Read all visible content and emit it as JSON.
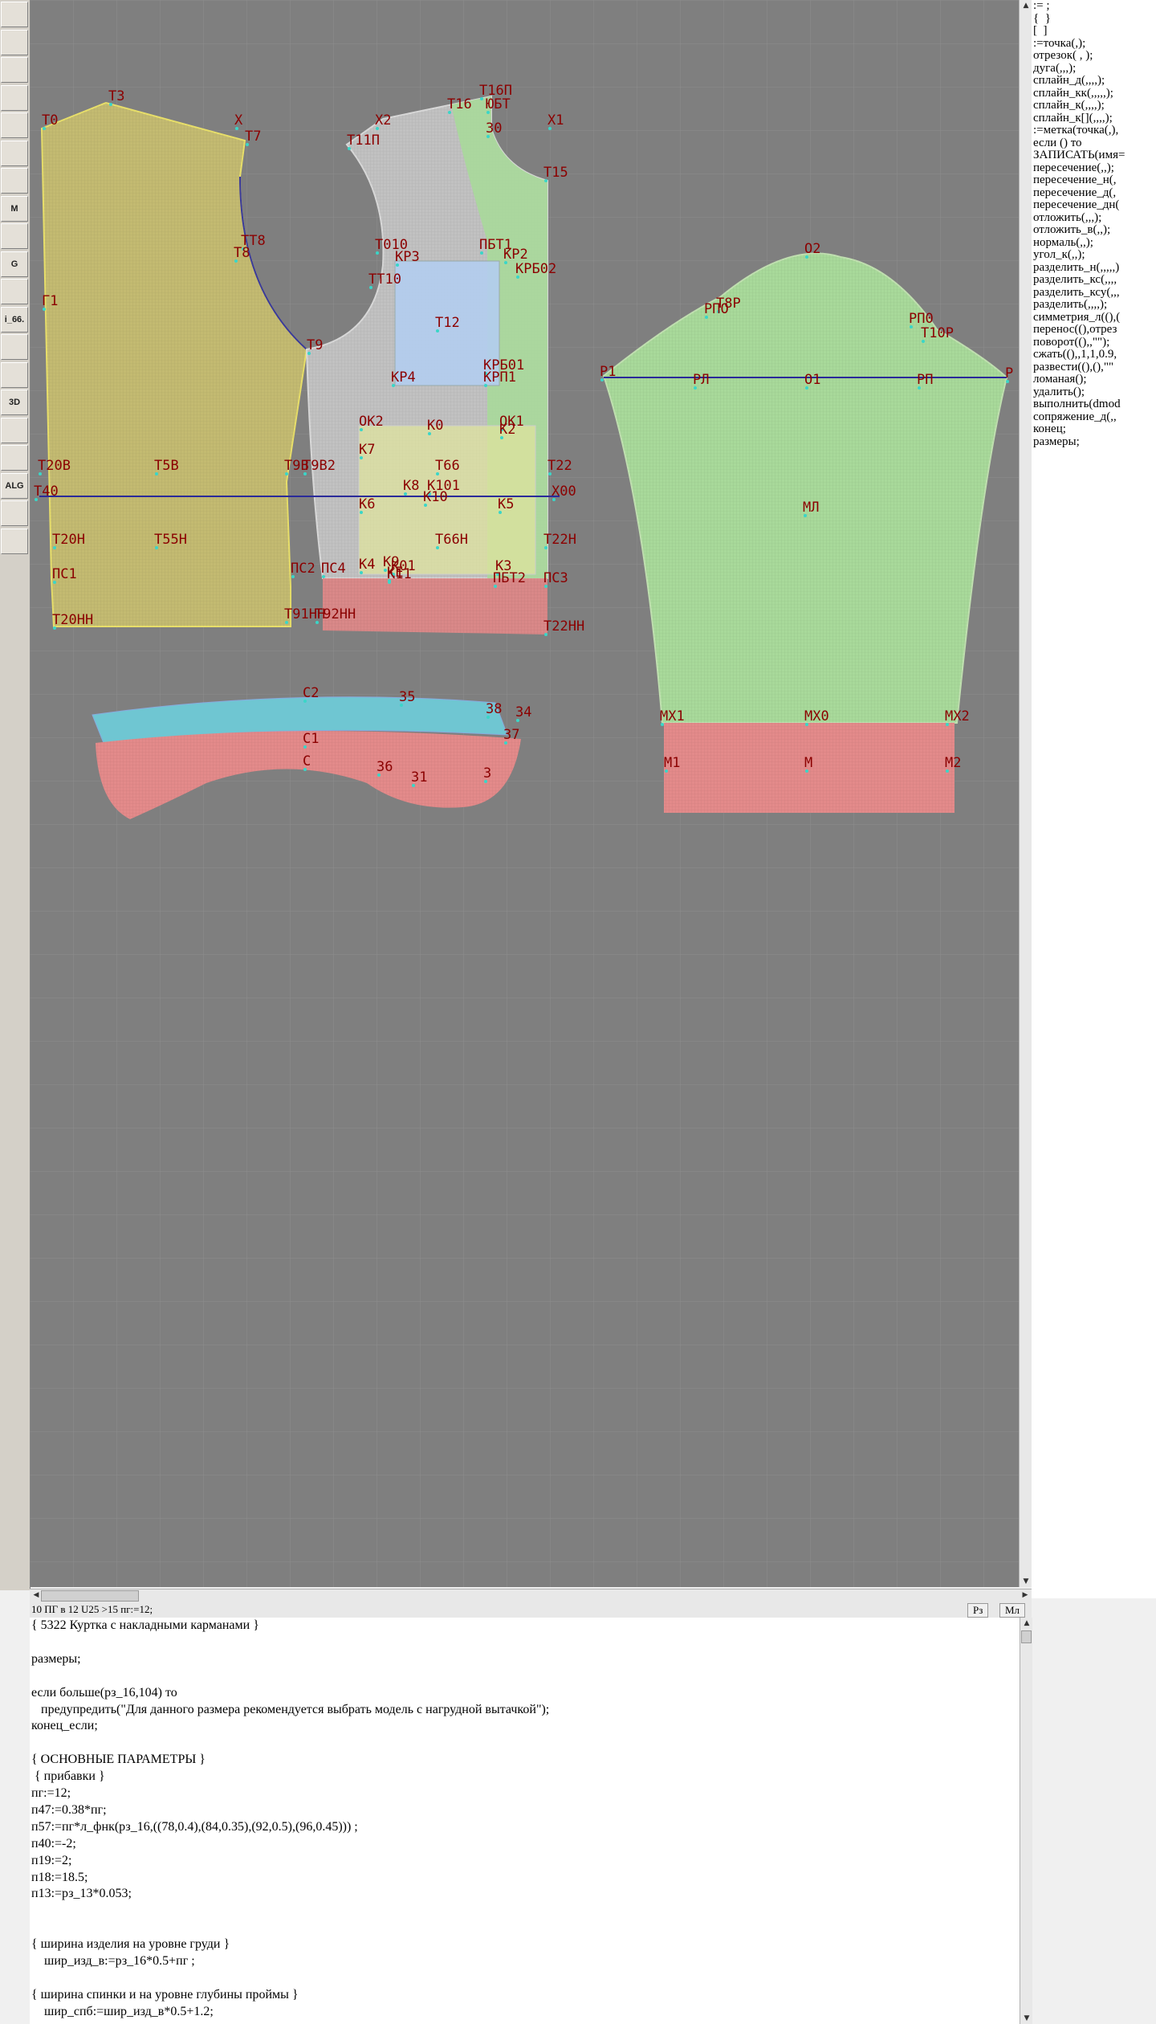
{
  "toolbar": {
    "buttons": [
      {
        "icon": "zoom-in-icon",
        "text": ""
      },
      {
        "icon": "zoom-out-icon",
        "text": ""
      },
      {
        "icon": "pattern-icon",
        "text": ""
      },
      {
        "icon": "grid-icon",
        "text": ""
      },
      {
        "icon": "line-icon",
        "text": ""
      },
      {
        "icon": "book-icon",
        "text": ""
      },
      {
        "icon": "ruler-icon",
        "text": ""
      },
      {
        "icon": "model-icon",
        "text": "M"
      },
      {
        "icon": "compass-icon",
        "text": ""
      },
      {
        "icon": "g-tool-icon",
        "text": "G"
      },
      {
        "icon": "measure-icon",
        "text": ""
      },
      {
        "icon": "file-label-icon",
        "text": "i_66."
      },
      {
        "icon": "spreadsheet-icon",
        "text": ""
      },
      {
        "icon": "figure-icon",
        "text": ""
      },
      {
        "icon": "3d-icon",
        "text": "3D"
      },
      {
        "icon": "layers-icon",
        "text": ""
      },
      {
        "icon": "stack-icon",
        "text": ""
      },
      {
        "icon": "algorithm-icon",
        "text": "ALG"
      },
      {
        "icon": "cut-icon",
        "text": ""
      },
      {
        "icon": "move-icon",
        "text": ""
      }
    ]
  },
  "canvas": {
    "colors": {
      "background": "#7f7f7f",
      "grid": "#8e8e8e",
      "back_fill": "#cfc46e",
      "front_fill": "#c9c9c9",
      "facing_fill": "#a8d99a",
      "pocket_fill": "#b3cdf0",
      "yoke_fill": "#dfe39d",
      "hem_fill": "#e38a8a",
      "collar_fill": "#6fc6d2",
      "sleeve_fill": "#a8d99a",
      "label": "#8b0000",
      "ref_line": "#2a2a9a"
    },
    "labels": {
      "back": [
        "Т0",
        "Т3",
        "Х",
        "Т7",
        "ТТ8",
        "Т8",
        "Г1",
        "Т9",
        "Т20В",
        "Т5В",
        "Т9В",
        "Т9В2",
        "Т40",
        "Т20Н",
        "Т55Н",
        "ПС1",
        "ПС2",
        "Т20НН",
        "Т91НН"
      ],
      "front": [
        "Х2",
        "Т16",
        "Т16П",
        "ЮБТ",
        "Т11П",
        "30",
        "Х1",
        "Т15",
        "Т010",
        "КР3",
        "ПБТ1",
        "КР2",
        "КРБ02",
        "ТТ10",
        "Т12",
        "КРБ01",
        "КР4",
        "КРП1",
        "ОК2",
        "К0",
        "ОК1",
        "К2",
        "К7",
        "Т66",
        "Т22",
        "К8",
        "К101",
        "К10",
        "Х00",
        "К6",
        "К5",
        "Т66Н",
        "Т22Н",
        "К4",
        "К9",
        "КЕ",
        "К01",
        "К3",
        "К11",
        "ПБТ2",
        "ПС3",
        "ПС4",
        "Т92НН",
        "Т22НН"
      ],
      "collar": [
        "С2",
        "35",
        "38",
        "34",
        "37",
        "С1",
        "С",
        "36",
        "31",
        "3"
      ],
      "sleeve": [
        "О2",
        "Т8Р",
        "РПО",
        "РП0",
        "Т10Р",
        "Р1",
        "РЛ",
        "О1",
        "РП",
        "Р",
        "МЛ",
        "МХ1",
        "МХ0",
        "МХ2",
        "М1",
        "М",
        "М2"
      ]
    }
  },
  "commands": [
    ":= ;",
    "{  }",
    "[  ]",
    ":=точка(,);",
    "отрезок( , );",
    "дуга(,,,);",
    "сплайн_д(,,,,);",
    "сплайн_кк(,,,,,);",
    "сплайн_к(,,,,);",
    "сплайн_к[](,,,,);",
    ":=метка(точка(,),",
    "если () то",
    "ЗАПИСАТЬ(имя=",
    "пересечение(,,);",
    "пересечение_н(,",
    "пересечение_д(,",
    "пересечение_дн(",
    "отложить(,,,);",
    "отложить_в(,,);",
    "нормаль(,,);",
    "угол_к(,,);",
    "разделить_н(,,,,,)",
    "разделить_кс(,,,,",
    "разделить_ксу(,,,",
    "разделить(,,,,);",
    "симметрия_л((),(",
    "перенос((),отрез",
    "поворот((),,\"\");",
    "сжать((),,1,1,0.9,",
    "развести((),(),\"\"",
    "ломаная();",
    "удалить();",
    "выполнить(dmod",
    "сопряжение_д(,,",
    "конец;",
    "размеры;"
  ],
  "statusbar": {
    "text": "10  ПГ в 12  U25     >15  пг:=12;",
    "btn_rz": "Рз",
    "btn_ml": "Мл"
  },
  "script": [
    "{ 5322 Куртка с накладными карманами }",
    "",
    "размеры;",
    "",
    "если больше(рз_16,104) то",
    "   предупредить(\"Для данного размера рекомендуется выбрать модель с нагрудной вытачкой\");",
    "конец_если;",
    "",
    "{ ОСНОВНЫЕ ПАРАМЕТРЫ }",
    " { прибавки }",
    "пг:=12;",
    "п47:=0.38*пг;",
    "п57:=пг*л_фнк(рз_16,((78,0.4),(84,0.35),(92,0.5),(96,0.45))) ;",
    "п40:=-2;",
    "п19:=2;",
    "п18:=18.5;",
    "п13:=рз_13*0.053;",
    "",
    "",
    "{ ширина изделия на уровне груди }",
    "    шир_изд_в:=рз_16*0.5+пг ;",
    "",
    "{ ширина спинки и на уровне глубины проймы }",
    "    шир_спб:=шир_изд_в*0.5+1.2;"
  ]
}
